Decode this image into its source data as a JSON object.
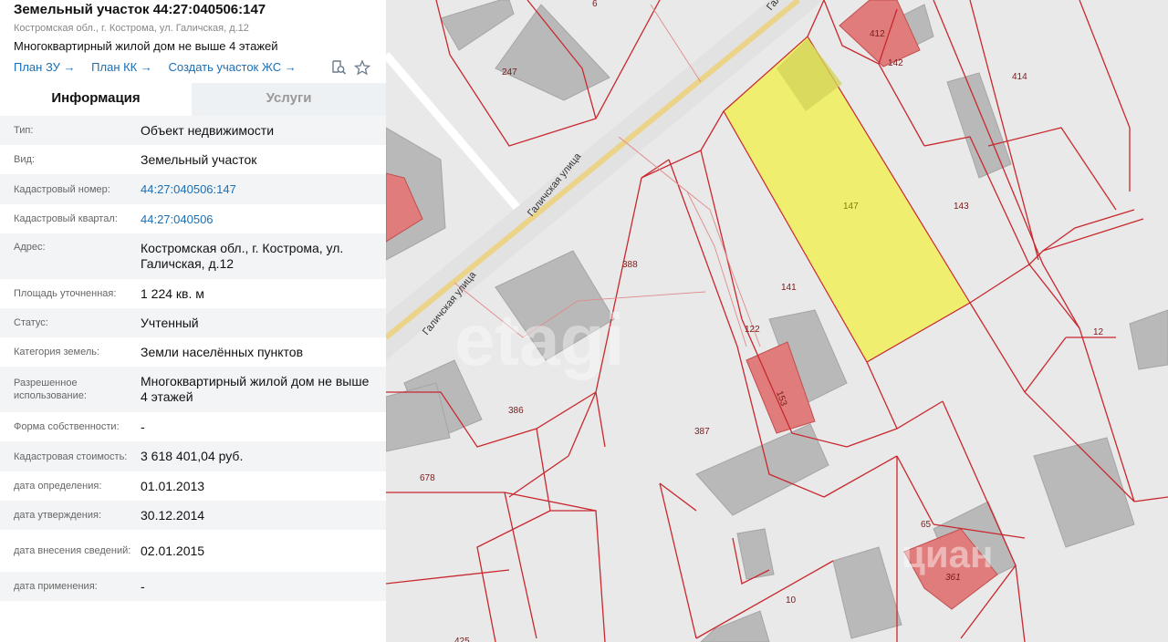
{
  "panel": {
    "title": "Земельный участок 44:27:040506:147",
    "address_small": "Костромская обл., г. Кострома, ул. Галичская, д.12",
    "description": "Многоквартирный жилой дом не выше 4 этажей",
    "links": [
      "План ЗУ →",
      "План КК →",
      "Создать участок ЖС →"
    ],
    "tabs": {
      "info": "Информация",
      "services": "Услуги"
    },
    "rows": [
      {
        "label": "Тип:",
        "value": "Объект недвижимости"
      },
      {
        "label": "Вид:",
        "value": "Земельный участок"
      },
      {
        "label": "Кадастровый номер:",
        "value": "44:27:040506:147",
        "link": true
      },
      {
        "label": "Кадастровый квартал:",
        "value": "44:27:040506",
        "link": true
      },
      {
        "label": "Адрес:",
        "value": "Костромская обл., г. Кострома, ул. Галичская, д.12"
      },
      {
        "label": "Площадь уточненная:",
        "value": "1 224 кв. м"
      },
      {
        "label": "Статус:",
        "value": "Учтенный"
      },
      {
        "label": "Категория земель:",
        "value": "Земли населённых пунктов"
      },
      {
        "label": "Разрешенное использование:",
        "value": "Многоквартирный жилой дом не выше 4 этажей"
      },
      {
        "label": "Форма собственности:",
        "value": "-"
      },
      {
        "label": "Кадастровая стоимость:",
        "value": "3 618 401,04 руб."
      },
      {
        "label": "дата определения:",
        "value": "01.01.2013"
      },
      {
        "label": "дата утверждения:",
        "value": "30.12.2014"
      },
      {
        "label": "дата внесения сведений:",
        "value": "02.01.2015"
      },
      {
        "label": "дата применения:",
        "value": "-"
      }
    ]
  },
  "map": {
    "street_name": "Галичская улица",
    "street_name_short": "Гал",
    "watermark": "etagi",
    "watermark2": "циан",
    "parcel_labels": {
      "p6": "6",
      "p412": "412",
      "p142": "142",
      "p414": "414",
      "p247": "247",
      "p147": "147",
      "p143": "143",
      "p388": "388",
      "p141": "141",
      "p122": "122",
      "p153": "153",
      "p12": "12",
      "p386": "386",
      "p387": "387",
      "p678": "678",
      "p65": "65",
      "p361": "361",
      "p10": "10",
      "p425": "425"
    },
    "colors": {
      "selected": "#f0ee6e",
      "boundary": "#c8282e",
      "building": "#b9b9b9",
      "registered_building": "#e07c7c",
      "road": "#f0d98a"
    }
  }
}
